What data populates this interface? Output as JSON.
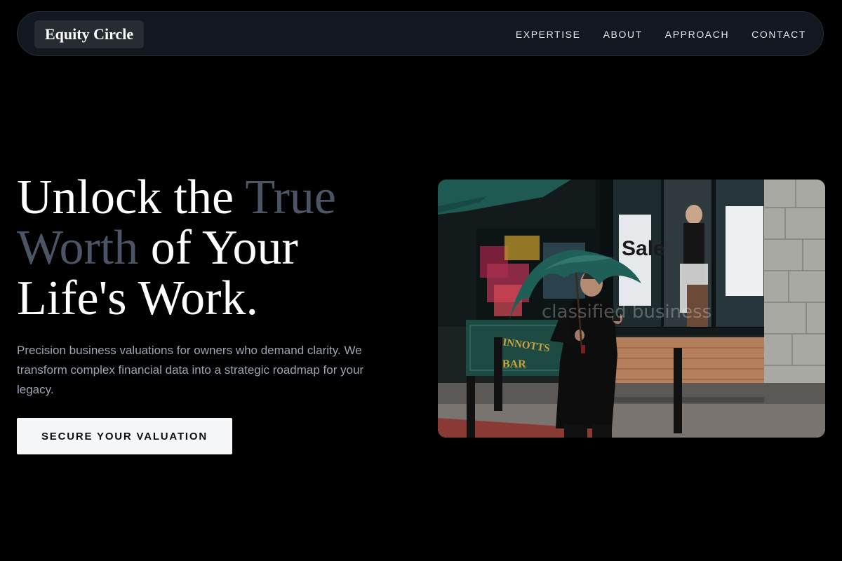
{
  "header": {
    "logo": "Equity Circle",
    "nav": [
      {
        "label": "EXPERTISE"
      },
      {
        "label": "ABOUT"
      },
      {
        "label": "APPROACH"
      },
      {
        "label": "CONTACT"
      }
    ]
  },
  "hero": {
    "title_line1": "Unlock the ",
    "title_accent1": "True",
    "title_accent2": "Worth",
    "title_line2_rest": " of Your",
    "title_line3": "Life's Work.",
    "subtitle": "Precision business valuations for owners who demand clarity. We transform complex financial data into a strategic roadmap for your legacy.",
    "cta_label": "SECURE YOUR VALUATION"
  },
  "photo": {
    "sign_sale": "Sale",
    "sign_bar_top": "INNOTTS",
    "sign_bar": "BAR",
    "watermark": "classified business"
  },
  "colors": {
    "background": "#000000",
    "nav_bg": "#131820",
    "accent_text": "#4b5566",
    "subtitle_text": "#9ba5b5",
    "cta_bg": "#f6f7f9"
  }
}
